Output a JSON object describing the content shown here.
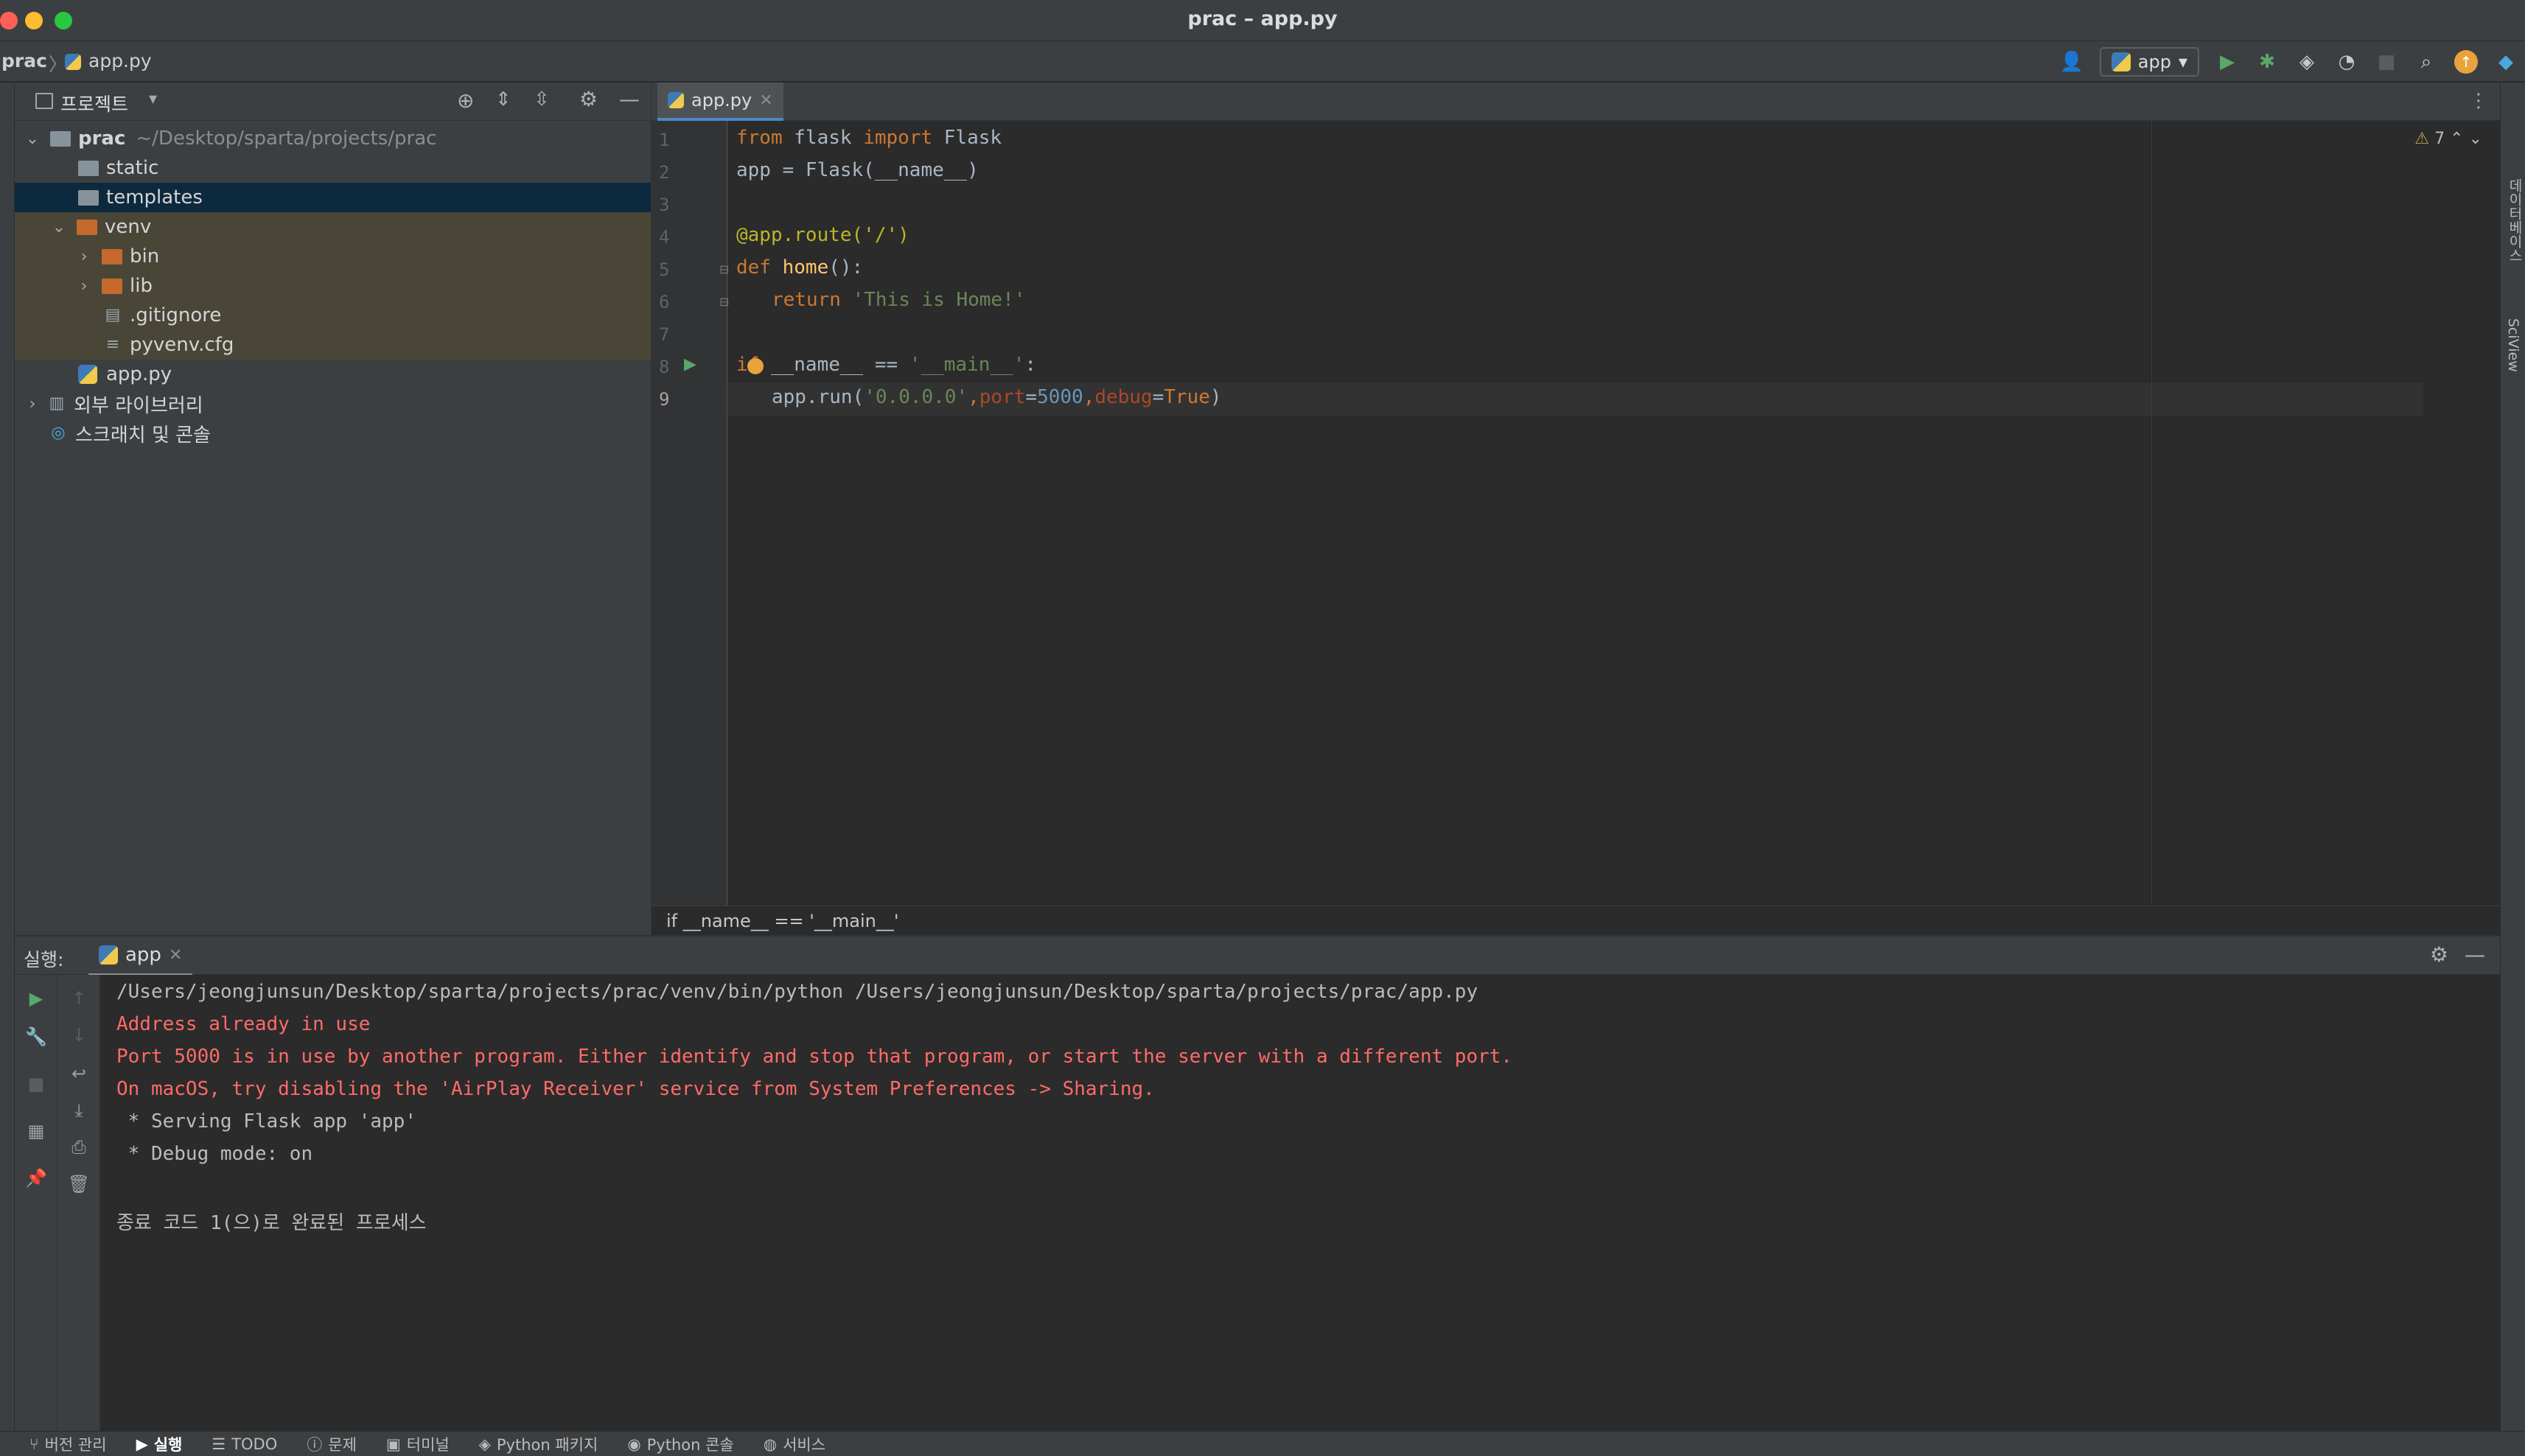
{
  "window": {
    "title": "prac – app.py"
  },
  "navbar": {
    "project": "prac",
    "file": "app.py",
    "run_config": "app"
  },
  "project_panel": {
    "title": "프로젝트",
    "root_name": "prac",
    "root_path": "~/Desktop/sparta/projects/prac",
    "items": [
      {
        "label": "static"
      },
      {
        "label": "templates"
      },
      {
        "label": "venv"
      },
      {
        "label": "bin"
      },
      {
        "label": "lib"
      },
      {
        "label": ".gitignore"
      },
      {
        "label": "pyvenv.cfg"
      },
      {
        "label": "app.py"
      },
      {
        "label": "외부 라이브러리"
      },
      {
        "label": "스크래치 및 콘솔"
      }
    ]
  },
  "editor": {
    "tab": "app.py",
    "warnings": "7",
    "line_numbers": [
      "1",
      "2",
      "3",
      "4",
      "5",
      "6",
      "7",
      "8",
      "9"
    ],
    "lines": {
      "l1": {
        "a": "from",
        "b": " flask ",
        "c": "import",
        "d": " Flask"
      },
      "l2": "app = Flask(__name__)",
      "l4": "@app.route('/')",
      "l5": {
        "a": "def ",
        "b": "home",
        "c": "():"
      },
      "l6": {
        "a": "return ",
        "b": "'This is Home!'"
      },
      "l8": {
        "a": "if ",
        "b": "__name__ == ",
        "c": "'__main__'",
        "d": ":"
      },
      "l9": {
        "a": "app.run(",
        "b": "'0.0.0.0'",
        "c": ",",
        "d": "port",
        "e": "=",
        "f": "5000",
        "g": ",",
        "h": "debug",
        "i": "=",
        "j": "True",
        "k": ")"
      }
    },
    "breadcrumb": "if __name__ == '__main__'"
  },
  "run_panel": {
    "label": "실행:",
    "tab": "app",
    "console": [
      "/Users/jeongjunsun/Desktop/sparta/projects/prac/venv/bin/python /Users/jeongjunsun/Desktop/sparta/projects/prac/app.py",
      "Address already in use",
      "Port 5000 is in use by another program. Either identify and stop that program, or start the server with a different port.",
      "On macOS, try disabling the 'AirPlay Receiver' service from System Preferences -> Sharing.",
      " * Serving Flask app 'app'",
      " * Debug mode: on",
      "종료 코드 1(으)로 완료된 프로세스"
    ]
  },
  "right_strip": {
    "tab1": "데이터베이스",
    "tab2": "SciView"
  },
  "statusbar": {
    "items": [
      "버전 관리",
      "실행",
      "TODO",
      "문제",
      "터미널",
      "Python 패키지",
      "Python 콘솔",
      "서비스"
    ]
  },
  "colors": {
    "accent": "#4a88c7",
    "error": "#ff6b68",
    "keyword": "#cc7832",
    "string": "#6a8759",
    "number": "#6897bb",
    "function": "#ffc66d"
  }
}
